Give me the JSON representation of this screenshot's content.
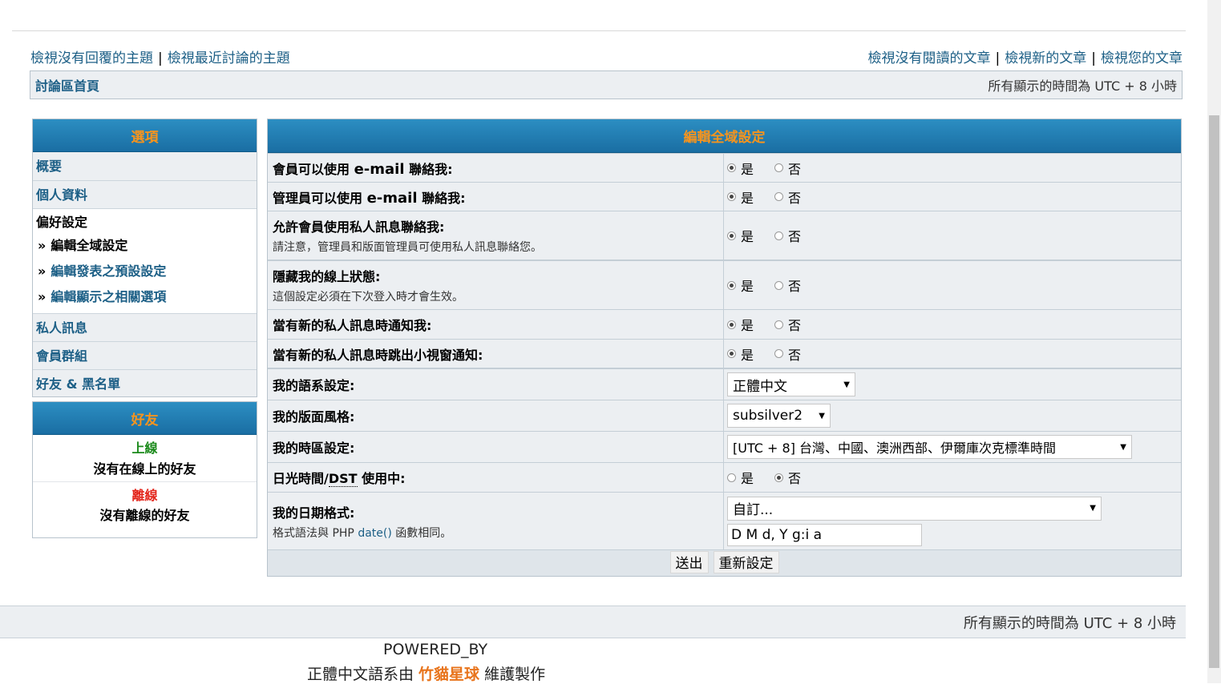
{
  "nav": {
    "left": [
      "檢視沒有回覆的主題",
      "檢視最近討論的主題"
    ],
    "right": [
      "檢視沒有閱讀的文章",
      "檢視新的文章",
      "檢視您的文章"
    ],
    "separator": "|"
  },
  "breadcrumb": {
    "home": "討論區首頁",
    "timezone_note": "所有顯示的時間為 UTC + 8 小時"
  },
  "sidebar": {
    "title": "選項",
    "items": [
      {
        "label": "概要"
      },
      {
        "label": "個人資料"
      }
    ],
    "group": {
      "title": "偏好設定",
      "subs": [
        {
          "label": "編輯全域設定",
          "active": true
        },
        {
          "label": "編輯發表之預設設定",
          "active": false
        },
        {
          "label": "編輯顯示之相關選項",
          "active": false
        }
      ]
    },
    "items_after": [
      {
        "label": "私人訊息"
      },
      {
        "label": "會員群組"
      },
      {
        "label": "好友 & 黑名單"
      }
    ],
    "subs_marker": "»"
  },
  "friends": {
    "title": "好友",
    "online_label": "上線",
    "online_text": "沒有在線上的好友",
    "offline_label": "離線",
    "offline_text": "沒有離線的好友"
  },
  "settings": {
    "title": "編輯全域設定",
    "yes": "是",
    "no": "否",
    "rows": [
      {
        "label_pre": "會員可以使用 ",
        "label_em": "e-mail",
        "label_post": " 聯絡我:",
        "value": "yes"
      },
      {
        "label_pre": "管理員可以使用 ",
        "label_em": "e-mail",
        "label_post": " 聯絡我:",
        "value": "yes"
      },
      {
        "label": "允許會員使用私人訊息聯絡我:",
        "note": "請注意，管理員和版面管理員可使用私人訊息聯絡您。",
        "value": "yes"
      },
      {
        "label": "隱藏我的線上狀態:",
        "note": "這個設定必須在下次登入時才會生效。",
        "value": "yes"
      },
      {
        "label": "當有新的私人訊息時通知我:",
        "value": "yes"
      },
      {
        "label": "當有新的私人訊息時跳出小視窗通知:",
        "value": "yes"
      }
    ],
    "language": {
      "label": "我的語系設定:",
      "selected": "正體中文"
    },
    "style": {
      "label": "我的版面風格:",
      "selected": "subsilver2"
    },
    "timezone": {
      "label": "我的時區設定:",
      "selected": "[UTC + 8] 台灣、中國、澳洲西部、伊爾庫次克標準時間"
    },
    "dst": {
      "label_pre": "日光時間/",
      "label_abbr": "DST",
      "label_post": " 使用中:",
      "value": "no"
    },
    "date_format": {
      "label": "我的日期格式:",
      "note_pre": "格式語法與 PHP ",
      "note_link": "date()",
      "note_post": " 函數相同。",
      "selected": "自訂...",
      "custom_value": "D M d, Y g:i a"
    },
    "submit_label": "送出",
    "reset_label": "重新設定"
  },
  "footer": {
    "timezone_note": "所有顯示的時間為 UTC + 8 小時",
    "powered_by": "POWERED_BY",
    "credits_pre": "正體中文語系由 ",
    "credits_team": "竹貓星球",
    "credits_post": " 維護製作"
  },
  "colors": {
    "header_gradient_top": "#2c8ec2",
    "header_text": "#f7941d",
    "link": "#1c5f86",
    "online": "#1b8a1b",
    "offline": "#e3261c"
  }
}
